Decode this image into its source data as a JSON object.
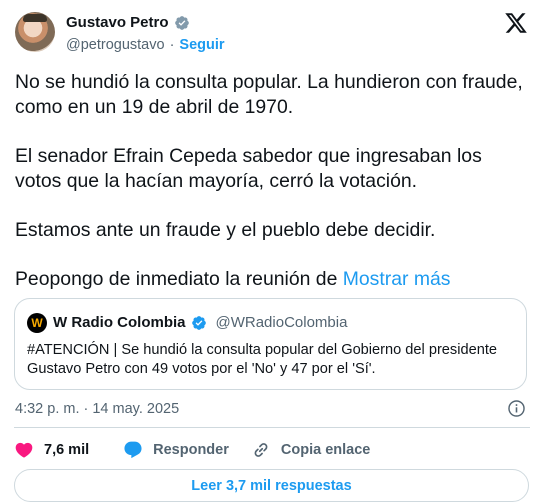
{
  "author": {
    "name": "Gustavo Petro",
    "handle": "@petrogustavo",
    "separator": "·",
    "follow_label": "Seguir"
  },
  "tweet": {
    "paragraphs": [
      "No se hundió la consulta popular. La hundieron con fraude, como en un 19 de abril de 1970.",
      "El senador Efrain Cepeda sabedor que ingresaban los votos que la hacían mayoría, cerró la votación.",
      "Estamos ante un fraude y el pueblo debe decidir."
    ],
    "truncated_text": "Peopongo de inmediato la reunión de",
    "show_more_label": "Mostrar más"
  },
  "quote": {
    "avatar_letter": "W",
    "name": "W Radio Colombia",
    "handle": "@WRadioColombia",
    "text": "#ATENCIÓN | Se hundió la consulta popular del Gobierno del presidente Gustavo Petro con 49 votos por el 'No' y 47 por el 'Sí'."
  },
  "meta": {
    "timestamp": "4:32 p. m. · 14 may. 2025"
  },
  "actions": {
    "likes": "7,6 mil",
    "reply_label": "Responder",
    "copy_label": "Copia enlace"
  },
  "replies_button": "Leer 3,7 mil respuestas",
  "colors": {
    "accent": "#1d9bf0",
    "like": "#f91880",
    "muted": "#536471"
  },
  "icons": [
    "verified-icon",
    "x-logo-icon",
    "info-icon",
    "heart-icon",
    "reply-bubble-icon",
    "link-icon"
  ]
}
